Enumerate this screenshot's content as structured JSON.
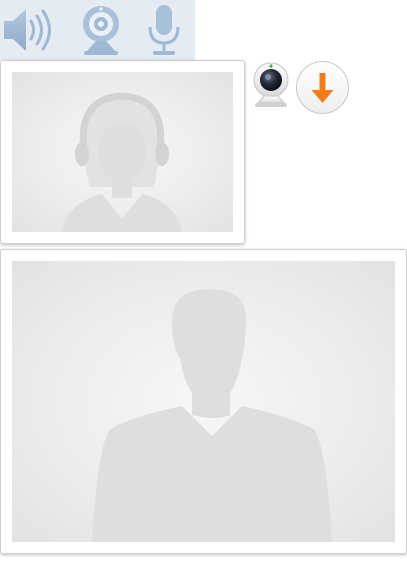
{
  "toolbar": {
    "icons": [
      "speaker-icon",
      "webcam-icon",
      "microphone-icon"
    ],
    "icon_color": "#9fb8d3",
    "background": "#e4ebf3"
  },
  "local_video": {
    "placeholder": "female-headset-silhouette"
  },
  "remote_video": {
    "placeholder": "male-silhouette"
  },
  "controls": {
    "camera_button_icon": "webcam-icon",
    "download_button_icon": "down-arrow-icon",
    "accent_color": "#f07d1a"
  }
}
